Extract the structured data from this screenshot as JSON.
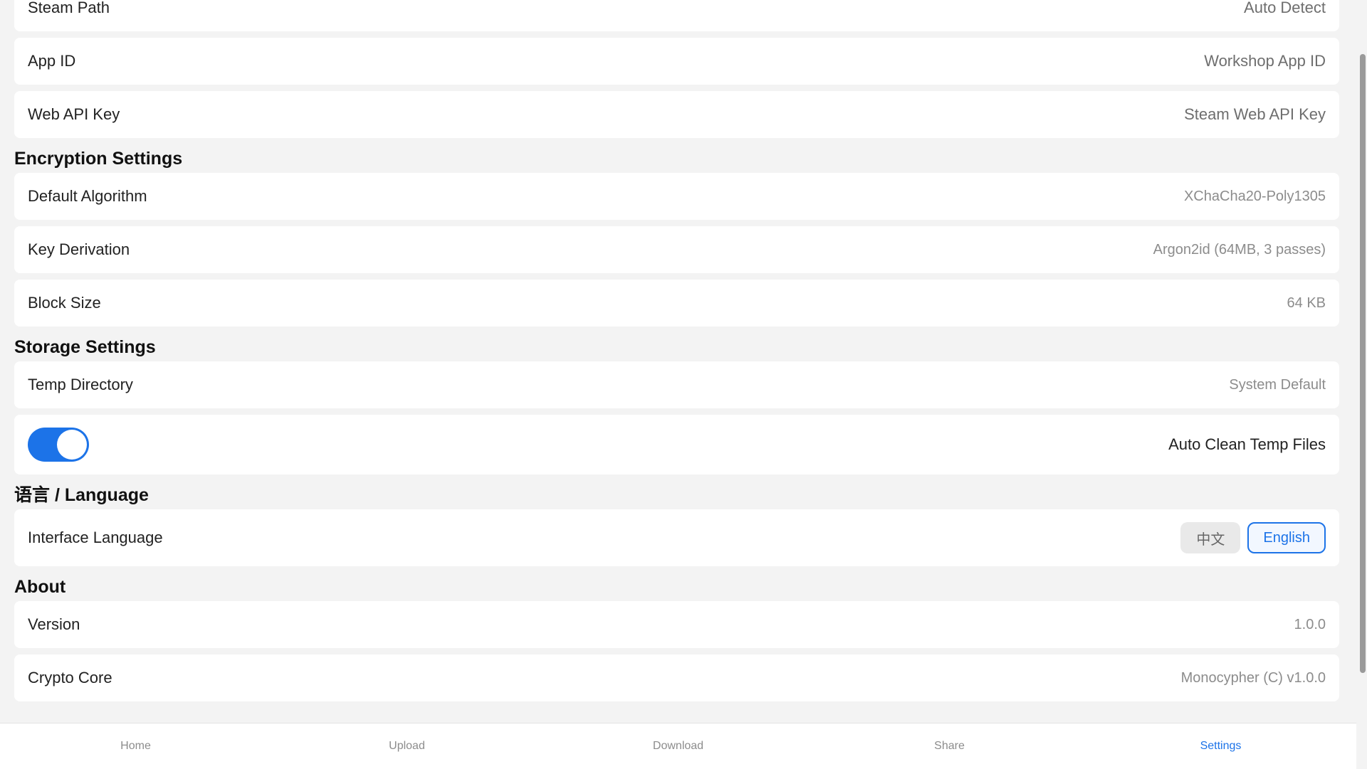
{
  "steam": {
    "path_label": "Steam Path",
    "path_value": "Auto Detect",
    "app_id_label": "App ID",
    "app_id_placeholder": "Workshop App ID",
    "api_key_label": "Web API Key",
    "api_key_placeholder": "Steam Web API Key"
  },
  "encryption": {
    "title": "Encryption Settings",
    "algorithm_label": "Default Algorithm",
    "algorithm_value": "XChaCha20-Poly1305",
    "kdf_label": "Key Derivation",
    "kdf_value": "Argon2id (64MB, 3 passes)",
    "block_label": "Block Size",
    "block_value": "64 KB"
  },
  "storage": {
    "title": "Storage Settings",
    "temp_label": "Temp Directory",
    "temp_value": "System Default",
    "auto_clean_label": "Auto Clean Temp Files",
    "auto_clean_enabled": true
  },
  "language": {
    "title": "语言 / Language",
    "interface_label": "Interface Language",
    "options": [
      "中文",
      "English"
    ],
    "selected": "English"
  },
  "about": {
    "title": "About",
    "version_label": "Version",
    "version_value": "1.0.0",
    "crypto_label": "Crypto Core",
    "crypto_value": "Monocypher (C) v1.0.0"
  },
  "nav": {
    "items": [
      "Home",
      "Upload",
      "Download",
      "Share",
      "Settings"
    ],
    "active": "Settings"
  },
  "colors": {
    "accent": "#1c73e8",
    "background": "#f3f3f3",
    "card": "#ffffff"
  }
}
